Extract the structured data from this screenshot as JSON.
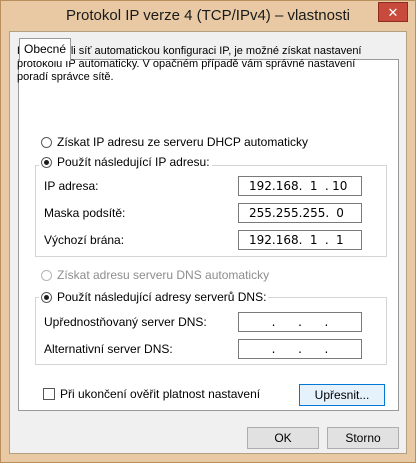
{
  "window": {
    "title": "Protokol IP verze 4 (TCP/IPv4) – vlastnosti",
    "close_glyph": "✕"
  },
  "tabs": [
    {
      "label": "Obecné",
      "active": true
    }
  ],
  "description": "Podporuje-li síť automatickou konfiguraci IP, je možné získat nastavení protokolu IP automaticky. V opačném případě vám správné nastavení poradí správce sítě.",
  "ip_mode": {
    "auto_label": "Získat IP adresu ze serveru DHCP automaticky",
    "manual_label": "Použít následující IP adresu:",
    "selected": "manual"
  },
  "ip_fields": {
    "ip_label": "IP adresa:",
    "ip_value": [
      "192",
      "168",
      "1",
      "10"
    ],
    "mask_label": "Maska podsítě:",
    "mask_value": [
      "255",
      "255",
      "255",
      "0"
    ],
    "gateway_label": "Výchozí brána:",
    "gateway_value": [
      "192",
      "168",
      "1",
      "1"
    ]
  },
  "dns_mode": {
    "auto_label": "Získat adresu serveru DNS automaticky",
    "manual_label": "Použít následující adresy serverů DNS:",
    "selected": "manual",
    "auto_enabled": false
  },
  "dns_fields": {
    "preferred_label": "Upřednostňovaný server DNS:",
    "preferred_value": [
      "",
      "",
      "",
      ""
    ],
    "alternate_label": "Alternativní server DNS:",
    "alternate_value": [
      "",
      "",
      "",
      ""
    ]
  },
  "validate": {
    "label": "Při ukončení ověřit platnost nastavení",
    "checked": false
  },
  "buttons": {
    "advanced": "Upřesnit...",
    "ok": "OK",
    "cancel": "Storno"
  },
  "colors": {
    "frame": "#e8c9a3",
    "close": "#c84a3c",
    "focus": "#0078d7"
  }
}
